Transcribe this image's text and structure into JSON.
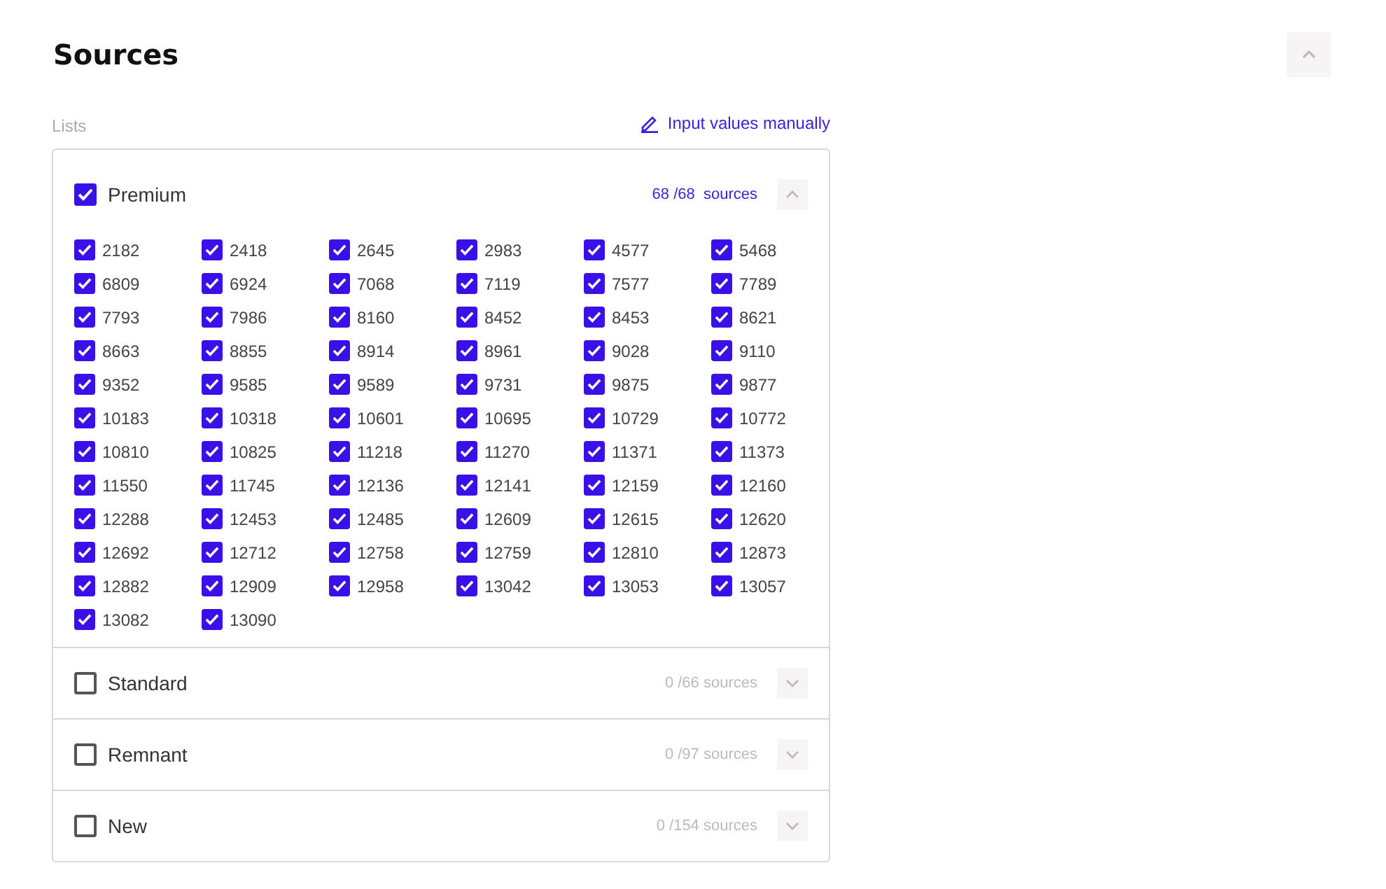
{
  "section": {
    "title": "Sources",
    "expanded": true
  },
  "lists_label": "Lists",
  "manual_link": "Input values manually",
  "groups": [
    {
      "label": "Premium",
      "checked": true,
      "count": "68 /68  sources",
      "expanded": true,
      "items": [
        {
          "label": "2182",
          "checked": true
        },
        {
          "label": "2418",
          "checked": true
        },
        {
          "label": "2645",
          "checked": true
        },
        {
          "label": "2983",
          "checked": true
        },
        {
          "label": "4577",
          "checked": true
        },
        {
          "label": "5468",
          "checked": true
        },
        {
          "label": "6809",
          "checked": true
        },
        {
          "label": "6924",
          "checked": true
        },
        {
          "label": "7068",
          "checked": true
        },
        {
          "label": "7119",
          "checked": true
        },
        {
          "label": "7577",
          "checked": true
        },
        {
          "label": "7789",
          "checked": true
        },
        {
          "label": "7793",
          "checked": true
        },
        {
          "label": "7986",
          "checked": true
        },
        {
          "label": "8160",
          "checked": true
        },
        {
          "label": "8452",
          "checked": true
        },
        {
          "label": "8453",
          "checked": true
        },
        {
          "label": "8621",
          "checked": true
        },
        {
          "label": "8663",
          "checked": true
        },
        {
          "label": "8855",
          "checked": true
        },
        {
          "label": "8914",
          "checked": true
        },
        {
          "label": "8961",
          "checked": true
        },
        {
          "label": "9028",
          "checked": true
        },
        {
          "label": "9110",
          "checked": true
        },
        {
          "label": "9352",
          "checked": true
        },
        {
          "label": "9585",
          "checked": true
        },
        {
          "label": "9589",
          "checked": true
        },
        {
          "label": "9731",
          "checked": true
        },
        {
          "label": "9875",
          "checked": true
        },
        {
          "label": "9877",
          "checked": true
        },
        {
          "label": "10183",
          "checked": true
        },
        {
          "label": "10318",
          "checked": true
        },
        {
          "label": "10601",
          "checked": true
        },
        {
          "label": "10695",
          "checked": true
        },
        {
          "label": "10729",
          "checked": true
        },
        {
          "label": "10772",
          "checked": true
        },
        {
          "label": "10810",
          "checked": true
        },
        {
          "label": "10825",
          "checked": true
        },
        {
          "label": "11218",
          "checked": true
        },
        {
          "label": "11270",
          "checked": true
        },
        {
          "label": "11371",
          "checked": true
        },
        {
          "label": "11373",
          "checked": true
        },
        {
          "label": "11550",
          "checked": true
        },
        {
          "label": "11745",
          "checked": true
        },
        {
          "label": "12136",
          "checked": true
        },
        {
          "label": "12141",
          "checked": true
        },
        {
          "label": "12159",
          "checked": true
        },
        {
          "label": "12160",
          "checked": true
        },
        {
          "label": "12288",
          "checked": true
        },
        {
          "label": "12453",
          "checked": true
        },
        {
          "label": "12485",
          "checked": true
        },
        {
          "label": "12609",
          "checked": true
        },
        {
          "label": "12615",
          "checked": true
        },
        {
          "label": "12620",
          "checked": true
        },
        {
          "label": "12692",
          "checked": true
        },
        {
          "label": "12712",
          "checked": true
        },
        {
          "label": "12758",
          "checked": true
        },
        {
          "label": "12759",
          "checked": true
        },
        {
          "label": "12810",
          "checked": true
        },
        {
          "label": "12873",
          "checked": true
        },
        {
          "label": "12882",
          "checked": true
        },
        {
          "label": "12909",
          "checked": true
        },
        {
          "label": "12958",
          "checked": true
        },
        {
          "label": "13042",
          "checked": true
        },
        {
          "label": "13053",
          "checked": true
        },
        {
          "label": "13057",
          "checked": true
        },
        {
          "label": "13082",
          "checked": true
        },
        {
          "label": "13090",
          "checked": true
        }
      ]
    },
    {
      "label": "Standard",
      "checked": false,
      "count": "0 /66 sources",
      "expanded": false
    },
    {
      "label": "Remnant",
      "checked": false,
      "count": "0 /97 sources",
      "expanded": false
    },
    {
      "label": "New",
      "checked": false,
      "count": "0 /154 sources",
      "expanded": false
    }
  ]
}
